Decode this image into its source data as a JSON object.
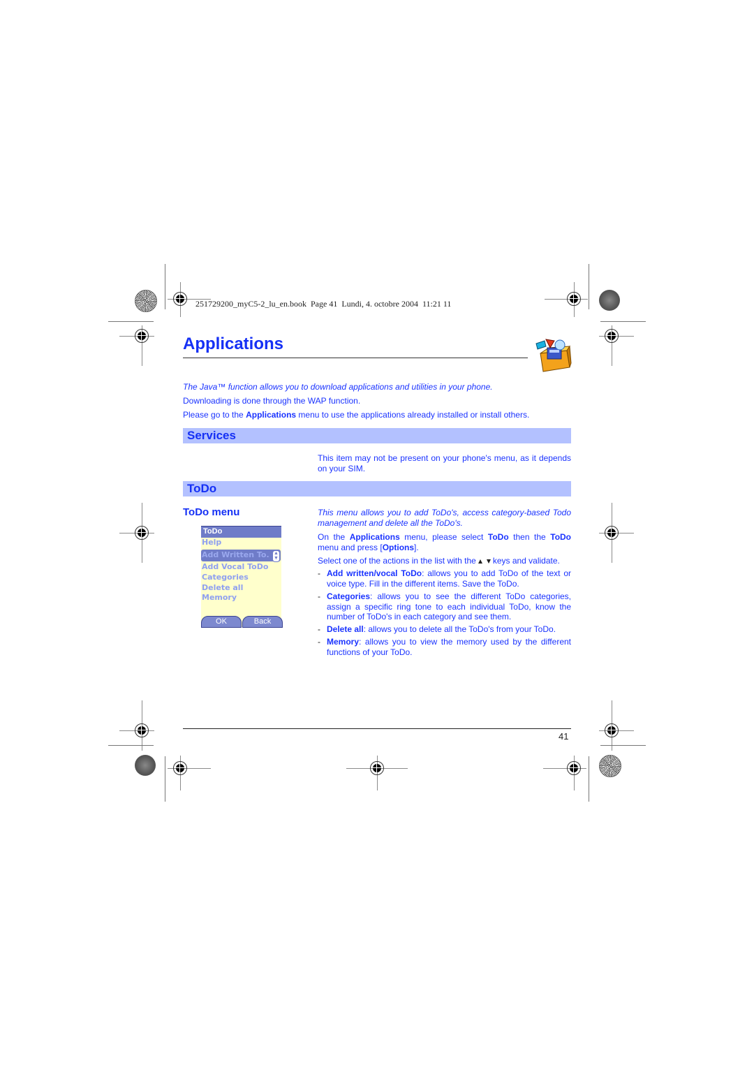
{
  "page_header": {
    "print_info": "251729200_myC5-2_lu_en.book  Page 41  Lundi, 4. octobre 2004  11:21 11"
  },
  "chapter": {
    "title": "Applications",
    "icon": "applications-box-icon"
  },
  "intro": {
    "italic_line": "The Java™ function allows you to download applications and utilities in your phone.",
    "line2": "Downloading is done through the WAP function.",
    "line3_pre": "Please go to the ",
    "line3_bold": "Applications",
    "line3_post": " menu to use the applications already installed or install others."
  },
  "services": {
    "heading": "Services",
    "note": "This item may not be present on your phone's menu, as it depends on your SIM."
  },
  "todo": {
    "heading": "ToDo",
    "subheading": "ToDo menu",
    "intro_italic": "This menu allows you to add ToDo's, access category-based Todo management and delete all the ToDo's.",
    "instr1": {
      "p1": "On the ",
      "b1": "Applications",
      "p2": " menu, please select ",
      "b2": "ToDo",
      "p3": " then the ",
      "b3": "ToDo",
      "p4": " menu and press [",
      "b4": "Options",
      "p5": "]."
    },
    "instr2_pre": "Select one of the actions in the list with the",
    "instr2_post": "keys and validate.",
    "bullets": [
      {
        "term": "Add written/vocal ToDo",
        "text": ": allows you to add ToDo of the text or voice type. Fill in the different items. Save the ToDo."
      },
      {
        "term": "Categories",
        "text": ": allows you to see the different ToDo categories, assign a specific ring tone to each individual ToDo, know the number of ToDo's in each category and see them."
      },
      {
        "term": "Delete all",
        "text": ": allows you to delete all the ToDo's from your ToDo."
      },
      {
        "term": "Memory",
        "text": ": allows you to view the memory used by the different functions of your ToDo."
      }
    ]
  },
  "phone_screen": {
    "title": "ToDo",
    "items": [
      "Help",
      "Add Written To.",
      "Add Vocal ToDo",
      "Categories",
      "Delete all",
      "Memory"
    ],
    "selected_index": 1,
    "softkeys": {
      "left": "OK",
      "right": "Back"
    }
  },
  "footer": {
    "page_number": "41"
  },
  "colors": {
    "text_blue": "#1a33ff",
    "heading_blue": "#1530f5",
    "band_bg": "#b3c1ff",
    "phone_bg": "#ffffcc",
    "phone_highlight": "#6f7cc8"
  }
}
